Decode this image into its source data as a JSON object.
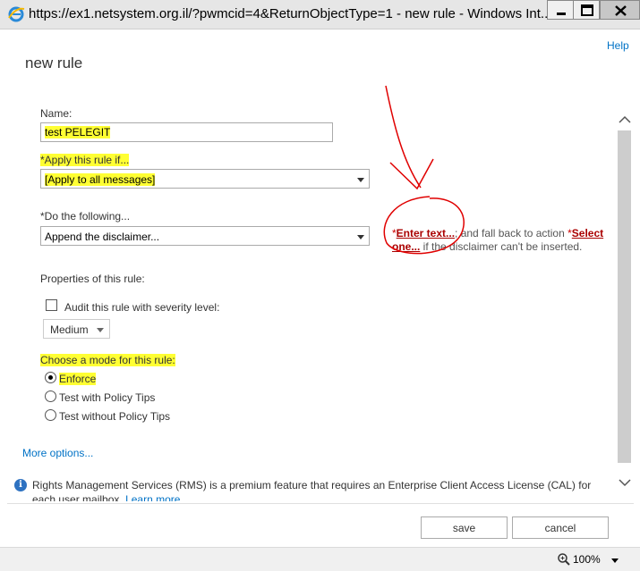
{
  "window": {
    "title": "https://ex1.netsystem.org.il/?pwmcid=4&ReturnObjectType=1 - new rule - Windows Int..."
  },
  "header": {
    "help_label": "Help",
    "page_title": "new rule"
  },
  "form": {
    "name_label": "Name:",
    "name_value": "test PELEGIT",
    "apply_label": "*Apply this rule if...",
    "apply_value": "[Apply to all messages]",
    "do_label": "*Do the following...",
    "do_value": "Append the disclaimer...",
    "action": {
      "asterisk1": "*",
      "enter_text_link": "Enter text...",
      "middle_text": "; and fall back to action ",
      "asterisk2": "*",
      "select_one_link": "Select one...",
      "tail_text": " if the disclaimer can't be inserted."
    },
    "properties_label": "Properties of this rule:",
    "audit_label": "Audit this rule with severity level:",
    "audit_checked": false,
    "severity_value": "Medium",
    "mode_label": "Choose a mode for this rule:",
    "modes": [
      {
        "label": "Enforce",
        "checked": true
      },
      {
        "label": "Test with Policy Tips",
        "checked": false
      },
      {
        "label": "Test without Policy Tips",
        "checked": false
      }
    ],
    "more_options_label": "More options..."
  },
  "info": {
    "text": "Rights Management Services (RMS) is a premium feature that requires an Enterprise Client Access License (CAL) for each user mailbox. ",
    "learn_more": "Learn more"
  },
  "footer": {
    "save_label": "save",
    "cancel_label": "cancel"
  },
  "status": {
    "zoom": "100%"
  },
  "colors": {
    "highlight": "#ffff33",
    "link": "#0072c6",
    "required_link": "#a00000",
    "annotation": "#e00000"
  }
}
